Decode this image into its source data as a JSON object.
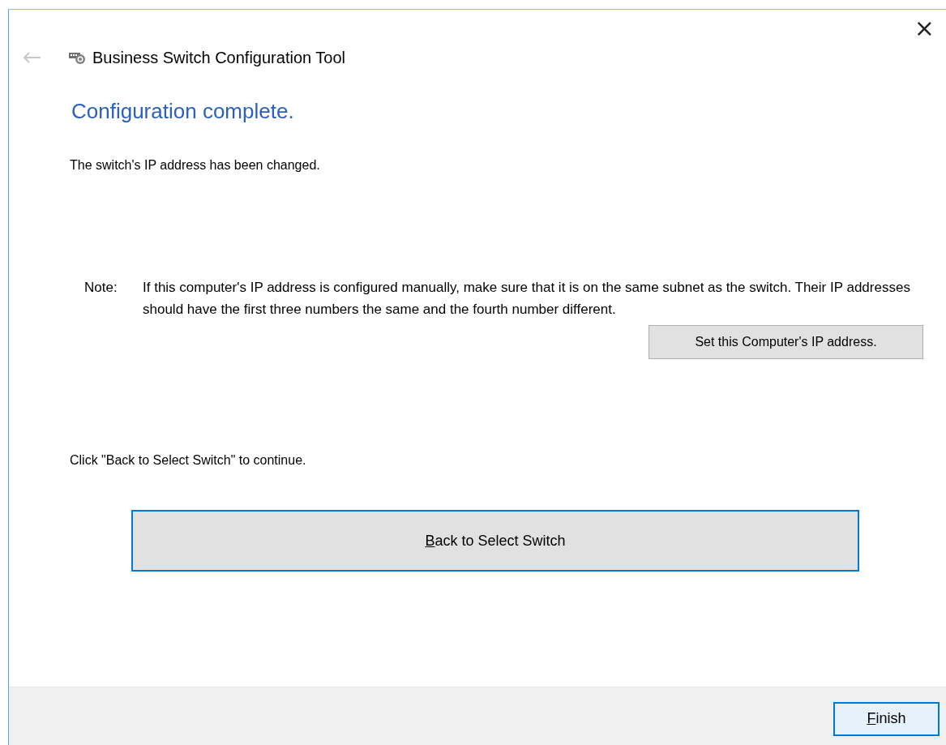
{
  "window": {
    "title": "Business Switch Configuration Tool",
    "close": "×"
  },
  "heading": "Configuration complete.",
  "message": "The switch's IP address has been changed.",
  "note": {
    "label": "Note:",
    "text": "If this computer's IP address is configured manually, make sure that it is on the same subnet as the switch. Their IP addresses should have the first three numbers the same and the fourth number different.",
    "button": {
      "label": "Set this Computer's IP address.",
      "focused": false
    }
  },
  "instruction": "Click \"Back to Select Switch\" to continue.",
  "main_button": {
    "label": "Back to Select Switch",
    "first_letter_underlined": true,
    "focused": true
  },
  "footer": {
    "buttons": [
      {
        "label": "Finish",
        "first_letter_underlined": true,
        "focused": false,
        "default": true
      }
    ]
  }
}
